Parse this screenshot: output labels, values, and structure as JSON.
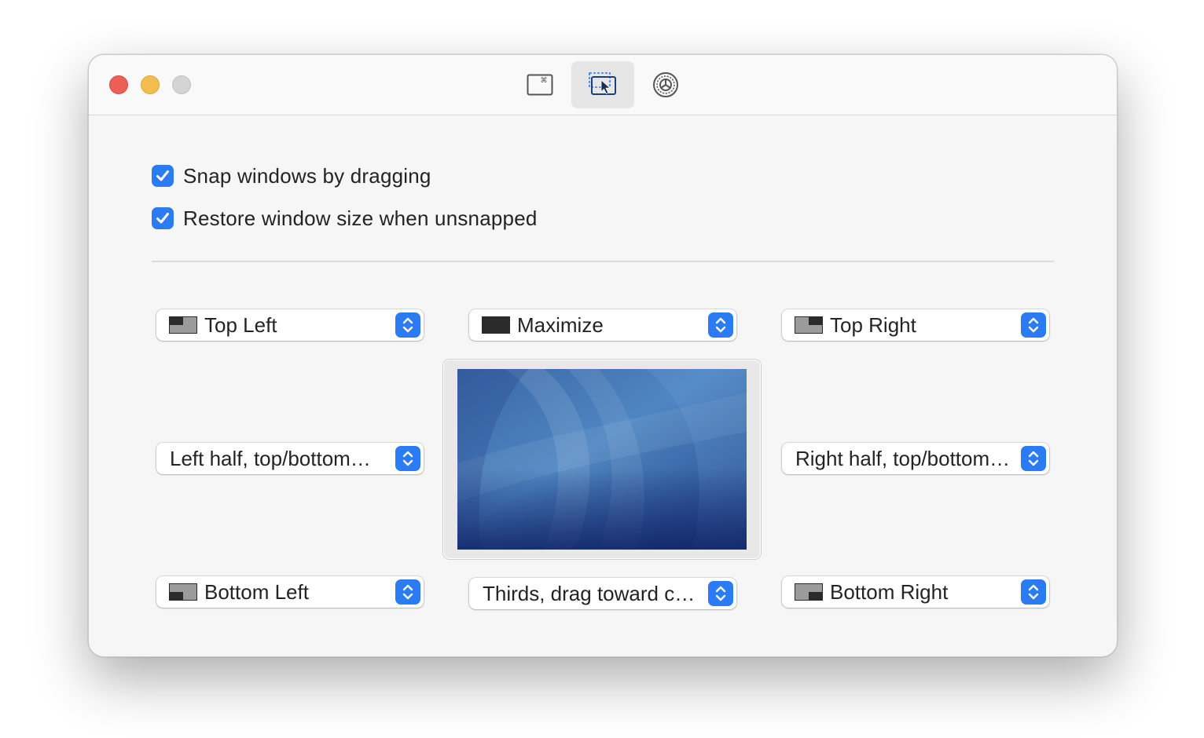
{
  "toolbar": {
    "tabs": [
      {
        "name": "keyboard-shortcuts",
        "icon": "keyboard-command-icon",
        "active": false
      },
      {
        "name": "snap-areas",
        "icon": "window-drag-cursor-icon",
        "active": true
      },
      {
        "name": "general-settings",
        "icon": "gear-icon",
        "active": false
      }
    ]
  },
  "settings": {
    "snap_windows": {
      "label": "Snap windows by dragging",
      "checked": true
    },
    "restore_size": {
      "label": "Restore window size when unsnapped",
      "checked": true
    }
  },
  "snap_areas": {
    "top_left": {
      "label": "Top Left",
      "icon": "top-left-quarter-icon"
    },
    "top_center": {
      "label": "Maximize",
      "icon": "maximize-icon"
    },
    "top_right": {
      "label": "Top Right",
      "icon": "top-right-quarter-icon"
    },
    "middle_left": {
      "label": "Left half, top/bottom…"
    },
    "middle_right": {
      "label": "Right half, top/bottom…"
    },
    "bottom_left": {
      "label": "Bottom Left",
      "icon": "bottom-left-quarter-icon"
    },
    "bottom_center": {
      "label": "Thirds, drag toward c…"
    },
    "bottom_right": {
      "label": "Bottom Right",
      "icon": "bottom-right-quarter-icon"
    }
  },
  "colors": {
    "accent": "#2a7bf4",
    "close": "#ec5f56",
    "minimize": "#f4be4f",
    "zoom_disabled": "#d4d4d4"
  }
}
